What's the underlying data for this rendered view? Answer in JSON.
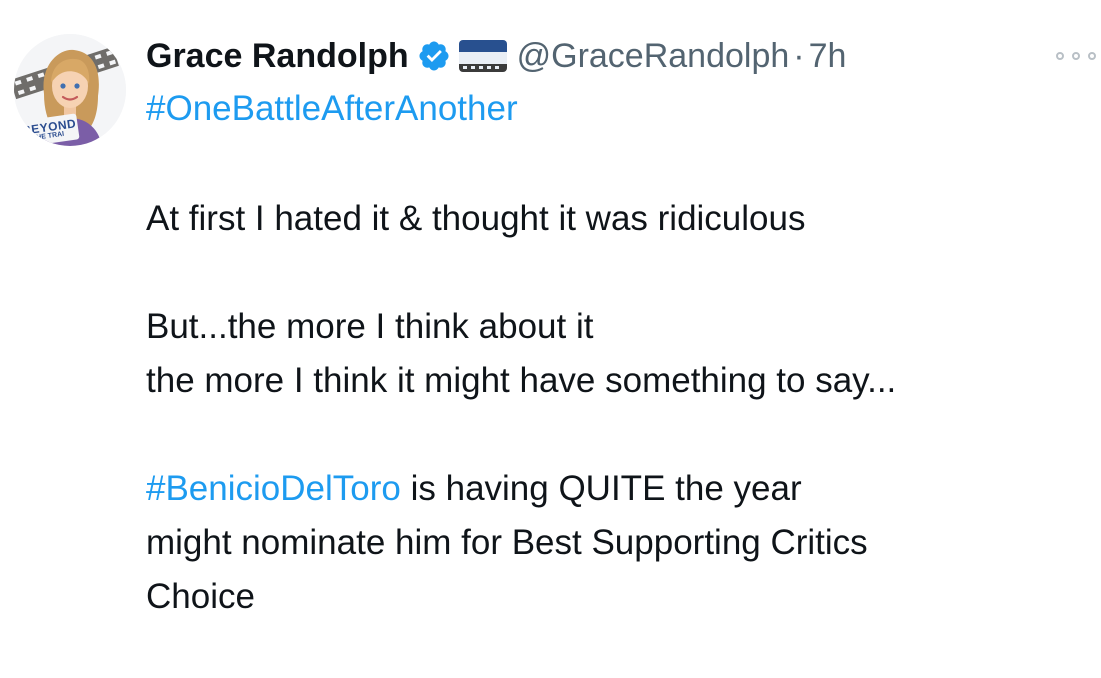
{
  "tweet": {
    "display_name": "Grace Randolph",
    "handle": "@GraceRandolph",
    "separator": "·",
    "time": "7h",
    "avatar_badge_line1": "BEYOND",
    "avatar_badge_line2": "THE TRAI",
    "affiliate_badge_line1": "BEYOND",
    "affiliate_badge_line2": "THE TRAILER",
    "verified_icon": "verified-badge-icon",
    "more_icon": "more-options-icon",
    "hashtag_top": "#OneBattleAfterAnother",
    "line_1": "At first I hated it & thought it was ridiculous",
    "line_2": "But...the more I think about it",
    "line_3": "the more I think it might have something to say...",
    "hashtag_bottom": "#BenicioDelToro",
    "line_4_rest": " is having QUITE the year",
    "line_5": "might nominate him for Best Supporting Critics",
    "line_6": "Choice"
  },
  "colors": {
    "hashtag": "#1d9bf0",
    "secondary_text": "#536471",
    "primary_text": "#0f1419",
    "verified": "#1d9bf0"
  }
}
